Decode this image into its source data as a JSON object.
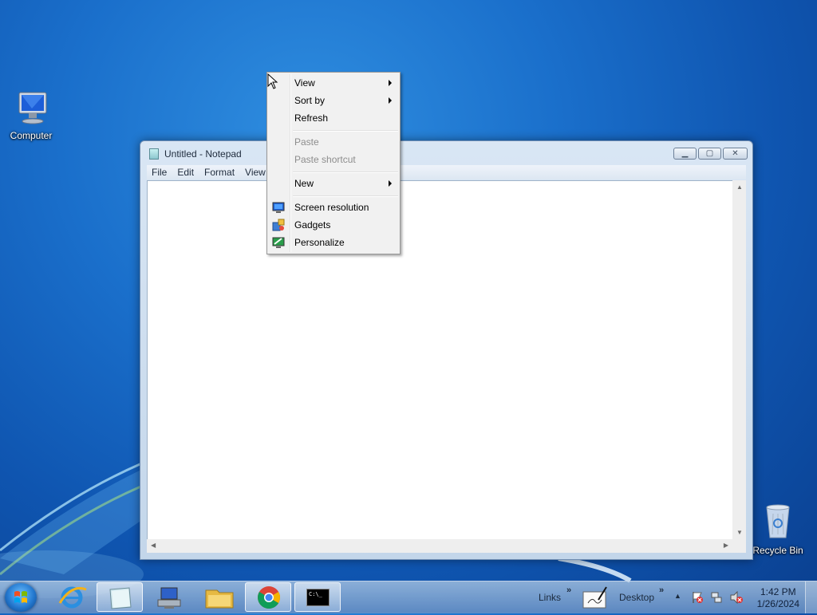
{
  "desktop": {
    "icons": [
      {
        "label": "Computer",
        "icon": "computer-icon"
      },
      {
        "label": "Recycle Bin",
        "icon": "recycle-bin-icon"
      }
    ]
  },
  "notepad": {
    "title": "Untitled - Notepad",
    "menu": [
      "File",
      "Edit",
      "Format",
      "View"
    ],
    "content": ""
  },
  "context_menu": {
    "items": [
      {
        "label": "View",
        "submenu": true
      },
      {
        "label": "Sort by",
        "submenu": true
      },
      {
        "label": "Refresh"
      },
      {
        "label": "Paste",
        "disabled": true
      },
      {
        "label": "Paste shortcut",
        "disabled": true
      },
      {
        "label": "New",
        "submenu": true
      },
      {
        "label": "Screen resolution",
        "icon": "screen-resolution-icon"
      },
      {
        "label": "Gadgets",
        "icon": "gadgets-icon"
      },
      {
        "label": "Personalize",
        "icon": "personalize-icon"
      }
    ]
  },
  "taskbar": {
    "toolbars": [
      "Links",
      "Desktop"
    ],
    "pinned": [
      "internet-explorer-icon",
      "notepad-icon",
      "network-computer-icon",
      "file-explorer-icon",
      "chrome-icon",
      "command-prompt-icon"
    ],
    "command_prompt_text": "C:\\_",
    "clock": {
      "time": "1:42 PM",
      "date": "1/26/2024"
    }
  }
}
